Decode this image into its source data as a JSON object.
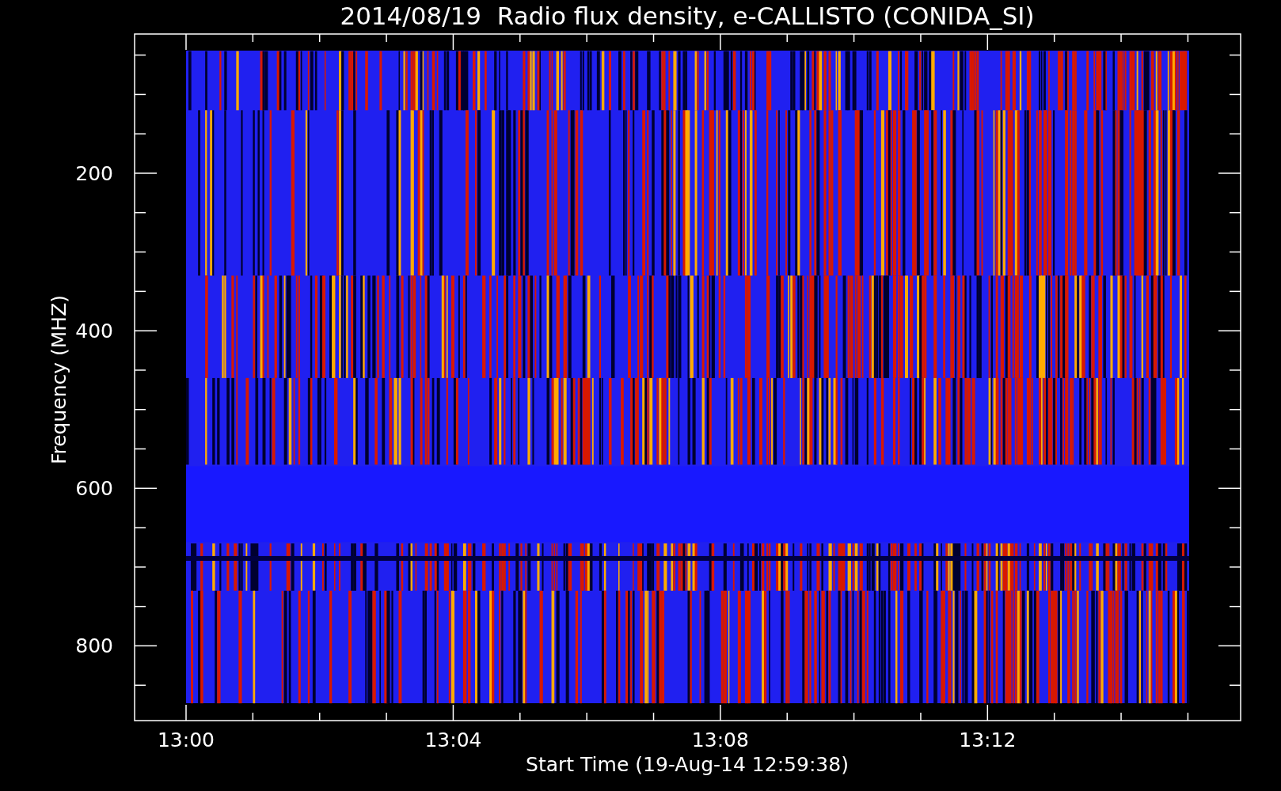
{
  "title": "2014/08/19  Radio flux density, e-CALLISTO (CONIDA_SI)",
  "y_axis": {
    "label": "Frequency (MHZ)",
    "ticks": [
      "200",
      "400",
      "600",
      "800"
    ]
  },
  "x_axis": {
    "label": "Start Time (19-Aug-14 12:59:38)",
    "ticks": [
      "13:00",
      "13:04",
      "13:08",
      "13:12"
    ]
  }
}
